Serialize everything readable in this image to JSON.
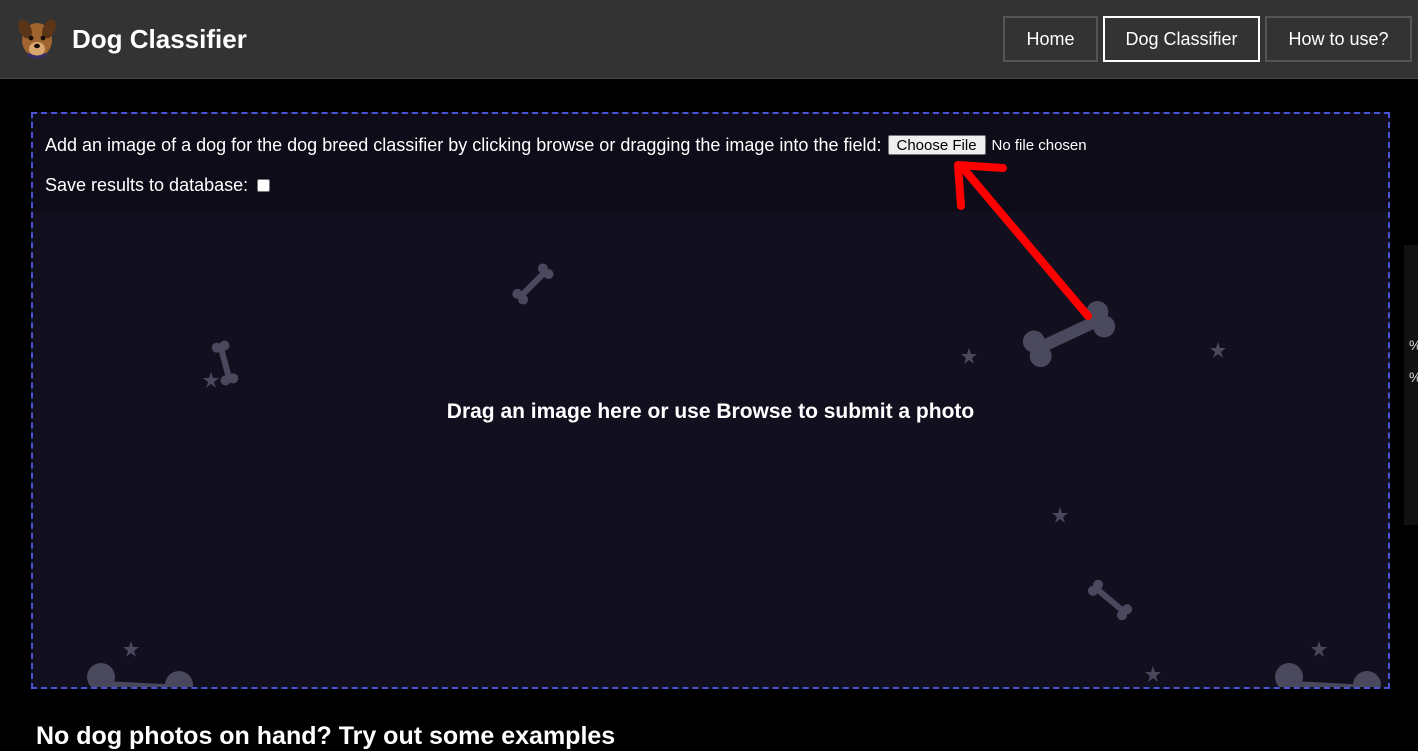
{
  "app": {
    "title": "Dog Classifier",
    "logo_icon": "dog-logo-icon"
  },
  "nav": {
    "items": [
      {
        "label": "Home",
        "active": false
      },
      {
        "label": "Dog Classifier",
        "active": true
      },
      {
        "label": "How to use?",
        "active": false
      }
    ]
  },
  "upload": {
    "instruction": "Add an image of a dog for the dog breed classifier by clicking browse or dragging the image into the field:",
    "file_button_label": "Choose File",
    "file_status": "No file chosen",
    "save_label": "Save results to database:",
    "save_checked": false,
    "drop_prompt": "Drag an image here or use Browse to submit a photo"
  },
  "examples": {
    "heading": "No dog photos on hand? Try out some examples"
  },
  "colors": {
    "navbar_bg": "#333333",
    "dropzone_border": "#4a52d6",
    "dropzone_bg": "#12101f",
    "annotation_arrow": "#ff0000"
  }
}
